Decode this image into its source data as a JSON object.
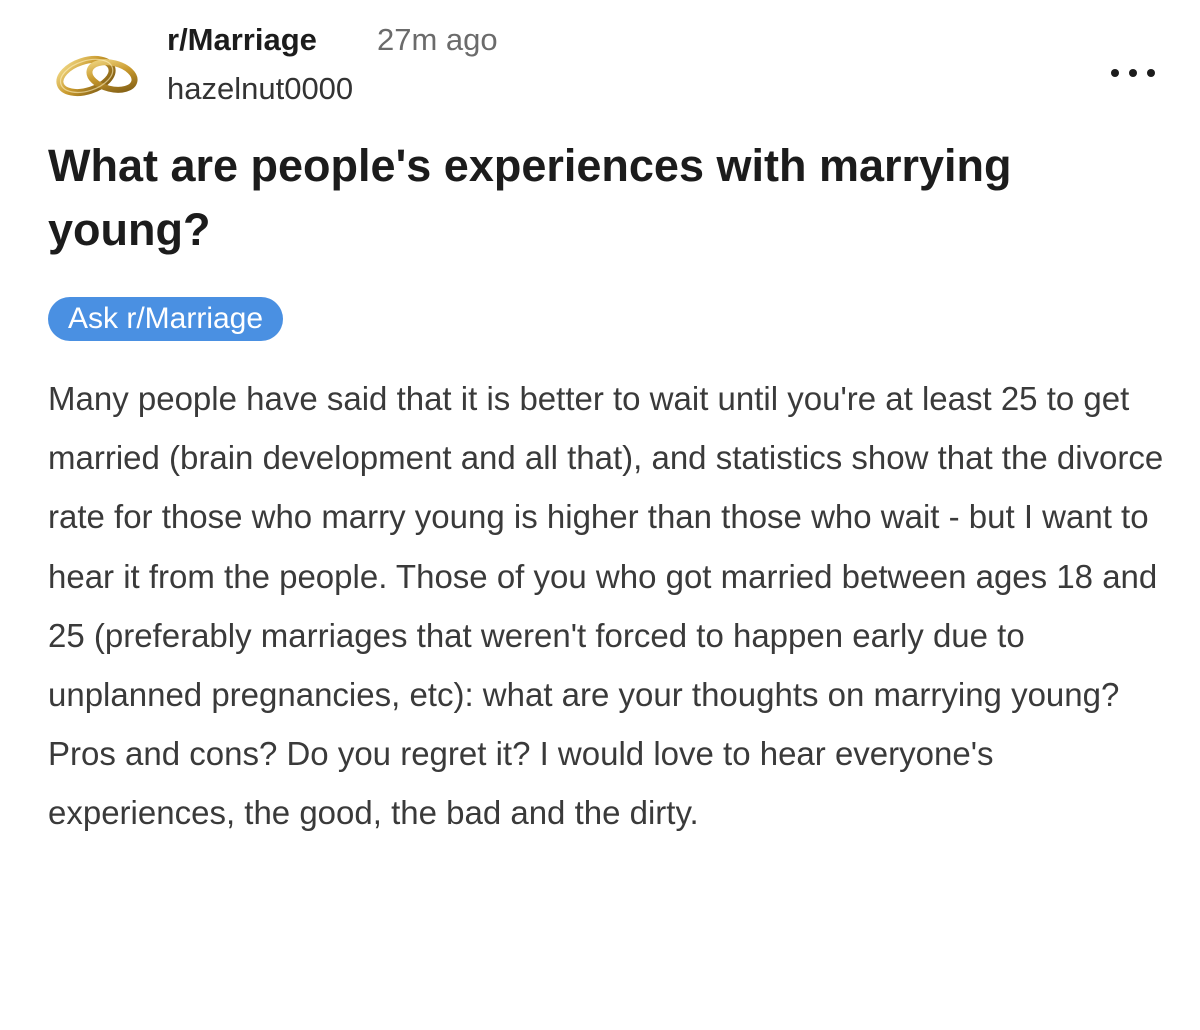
{
  "post": {
    "community": "r/Marriage",
    "time_ago": "27m ago",
    "username": "hazelnut0000",
    "avatar_icon": "wedding-rings-icon",
    "more_icon": "more-options-icon",
    "title": "What are people's experiences with marrying young?",
    "flair": "Ask r/Marriage",
    "flair_color": "#4a90e2",
    "body": "Many people have said that it is better to wait until you're at least 25 to get married (brain development and all that), and statistics show that the divorce rate for those who marry young is higher than those who wait - but I want to hear it from the people. Those of you who got married between ages 18 and 25 (preferably marriages that weren't forced to happen early due to unplanned pregnancies, etc): what are your thoughts on marrying young? Pros and cons? Do you regret it? I would love to hear everyone's experiences, the good, the bad and the dirty."
  }
}
